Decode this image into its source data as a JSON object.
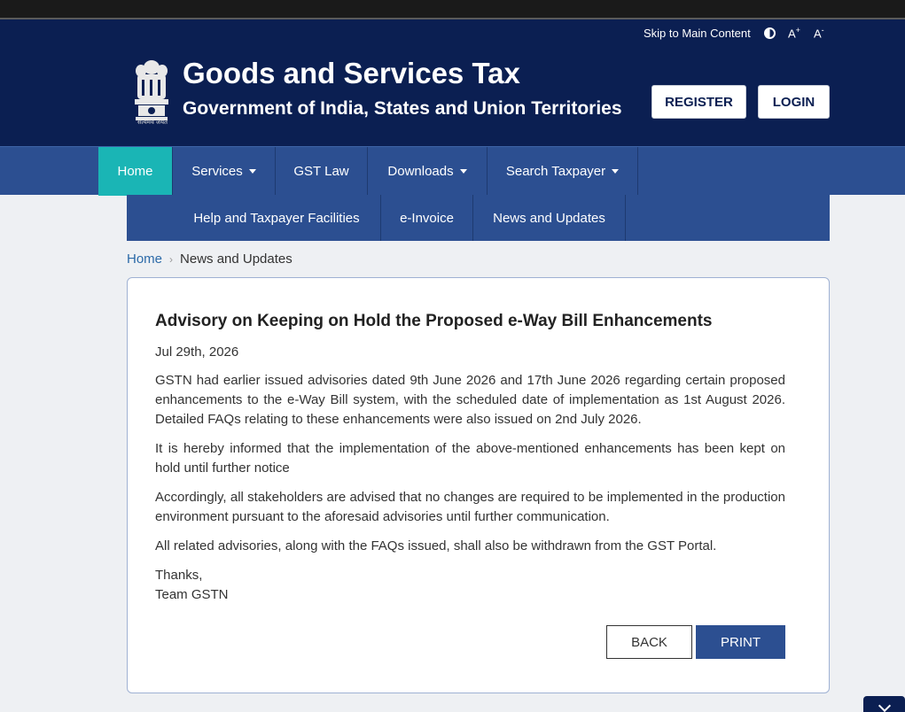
{
  "util": {
    "skip_label": "Skip to Main Content",
    "font_increase": "A",
    "font_increase_sup": "+",
    "font_decrease": "A",
    "font_decrease_sup": "-"
  },
  "header": {
    "title": "Goods and Services Tax",
    "subtitle": "Government of India, States and Union Territories",
    "emblem_caption": "सत्यमेव जयते",
    "register_label": "REGISTER",
    "login_label": "LOGIN"
  },
  "nav": {
    "items": [
      {
        "label": "Home"
      },
      {
        "label": "Services"
      },
      {
        "label": "GST Law"
      },
      {
        "label": "Downloads"
      },
      {
        "label": "Search Taxpayer"
      }
    ],
    "sub_items": [
      {
        "label": "Help and Taxpayer Facilities"
      },
      {
        "label": "e-Invoice"
      },
      {
        "label": "News and Updates"
      }
    ]
  },
  "breadcrumb": {
    "home": "Home",
    "current": "News and Updates"
  },
  "article": {
    "title": "Advisory on Keeping on Hold the Proposed e-Way Bill Enhancements",
    "date": "Jul 29th, 2026",
    "paragraphs": [
      "GSTN had earlier issued advisories dated 9th June 2026 and 17th June 2026 regarding certain proposed enhancements to the e-Way Bill system, with the scheduled date of implementation as 1st August 2026. Detailed FAQs relating to these enhancements were also issued on 2nd July 2026.",
      "It is hereby informed that the implementation of the above-mentioned enhancements has been kept on hold until further notice",
      "Accordingly, all stakeholders are advised that no changes are required to be implemented in the production environment pursuant to the aforesaid advisories until further communication.",
      "All related advisories, along with the FAQs issued, shall also be withdrawn from the GST Portal."
    ],
    "thanks": "Thanks,",
    "signature": "Team GSTN",
    "back_label": "BACK",
    "print_label": "PRINT"
  },
  "colors": {
    "header_bg": "#0b1f52",
    "nav_bg": "#2c4f91",
    "nav_active": "#1ab5b5"
  }
}
